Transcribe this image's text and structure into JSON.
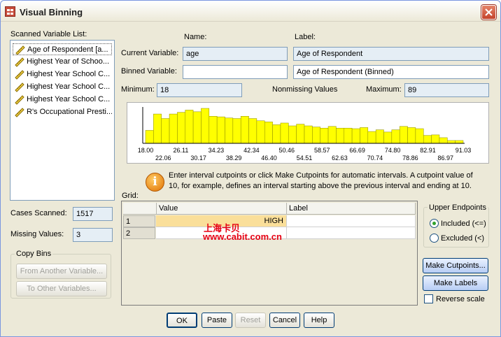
{
  "window": {
    "title": "Visual Binning"
  },
  "scanned_list": {
    "label": "Scanned Variable List:",
    "items": [
      {
        "label": "Age of Respondent [a..."
      },
      {
        "label": "Highest Year of Schoo..."
      },
      {
        "label": "Highest Year School C..."
      },
      {
        "label": "Highest Year School C..."
      },
      {
        "label": "Highest Year School C..."
      },
      {
        "label": "R's Occupational Presti..."
      }
    ]
  },
  "variable": {
    "name_header": "Name:",
    "label_header": "Label:",
    "current_label": "Current Variable:",
    "current_name": "age",
    "current_var_label": "Age of Respondent",
    "binned_label": "Binned Variable:",
    "binned_name": "",
    "binned_var_label": "Age of Respondent (Binned)",
    "minimum_label": "Minimum:",
    "minimum": "18",
    "nonmissing_label": "Nonmissing Values",
    "maximum_label": "Maximum:",
    "maximum": "89"
  },
  "chart_data": {
    "type": "bar",
    "x_tick_labels_row1": [
      "18.00",
      "26.11",
      "34.23",
      "42.34",
      "50.46",
      "58.57",
      "66.69",
      "74.80",
      "82.91",
      "91.03"
    ],
    "x_tick_labels_row2": [
      "22.06",
      "30.17",
      "38.29",
      "46.40",
      "54.51",
      "62.63",
      "70.74",
      "78.86",
      "86.97"
    ],
    "values": [
      23,
      52,
      44,
      52,
      55,
      59,
      56,
      62,
      48,
      47,
      45,
      44,
      48,
      44,
      40,
      38,
      33,
      36,
      31,
      34,
      31,
      29,
      27,
      30,
      27,
      27,
      26,
      28,
      21,
      24,
      20,
      24,
      30,
      28,
      26,
      14,
      15,
      10,
      5,
      5
    ],
    "bar_color": "#ffff00",
    "ylim": [
      0,
      62
    ]
  },
  "info": {
    "message": "Enter interval cutpoints or click Make Cutpoints for automatic intervals. A cutpoint value of 10, for example, defines an interval starting above the previous interval and ending at 10."
  },
  "stats": {
    "cases_scanned_label": "Cases Scanned:",
    "cases_scanned": "1517",
    "missing_values_label": "Missing Values:",
    "missing_values": "3"
  },
  "copy_bins": {
    "title": "Copy Bins",
    "from_label": "From Another Variable...",
    "to_label": "To Other Variables..."
  },
  "grid": {
    "title": "Grid:",
    "col_value": "Value",
    "col_label": "Label",
    "rows": [
      {
        "num": "1",
        "value": "HIGH",
        "label": ""
      },
      {
        "num": "2",
        "value": "",
        "label": ""
      }
    ]
  },
  "upper_endpoints": {
    "title": "Upper Endpoints",
    "included": "Included (<=)",
    "excluded": "Excluded (<)"
  },
  "actions": {
    "make_cutpoints": "Make Cutpoints...",
    "make_labels": "Make Labels",
    "reverse_scale": "Reverse scale"
  },
  "buttons": {
    "ok": "OK",
    "paste": "Paste",
    "reset": "Reset",
    "cancel": "Cancel",
    "help": "Help"
  },
  "watermark": {
    "line1": "上海卡贝",
    "line2": "www.cabit.com.cn"
  }
}
